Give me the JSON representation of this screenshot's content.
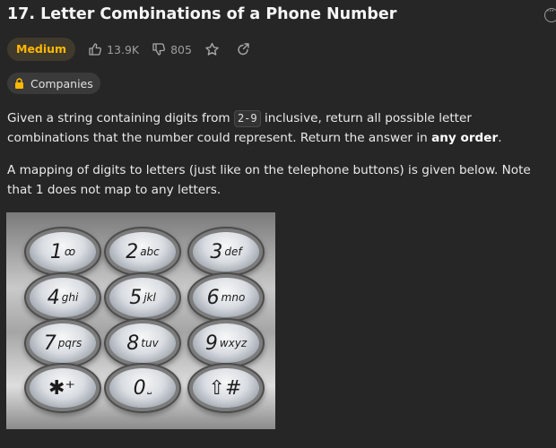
{
  "problem": {
    "title": "17. Letter Combinations of a Phone Number",
    "difficulty": "Medium",
    "likes": "13.9K",
    "dislikes": "805",
    "companies_label": "Companies"
  },
  "icons": {
    "more": "more-icon",
    "like": "thumbs-up-icon",
    "dislike": "thumbs-down-icon",
    "star": "star-icon",
    "share": "share-icon",
    "lock": "lock-icon"
  },
  "colors": {
    "medium": "#ffb800",
    "background": "#262626",
    "lock": "#ffb800"
  },
  "description": {
    "p1_before": "Given a string containing digits from ",
    "p1_code": "2-9",
    "p1_after": " inclusive, return all possible letter combinations that the number could represent. Return the answer in ",
    "p1_bold": "any order",
    "p1_end": ".",
    "p2": "A mapping of digits to letters (just like on the telephone buttons) is given below. Note that 1 does not map to any letters."
  },
  "keypad": [
    {
      "num": "1",
      "letters": "ꝏ"
    },
    {
      "num": "2",
      "letters": "abc"
    },
    {
      "num": "3",
      "letters": "def"
    },
    {
      "num": "4",
      "letters": "ghi"
    },
    {
      "num": "5",
      "letters": "jkl"
    },
    {
      "num": "6",
      "letters": "mno"
    },
    {
      "num": "7",
      "letters": "pqrs"
    },
    {
      "num": "8",
      "letters": "tuv"
    },
    {
      "num": "9",
      "letters": "wxyz"
    },
    {
      "num": "✱⁺",
      "letters": ""
    },
    {
      "num": "0",
      "letters": "⎵"
    },
    {
      "num": "⇧#",
      "letters": ""
    }
  ]
}
